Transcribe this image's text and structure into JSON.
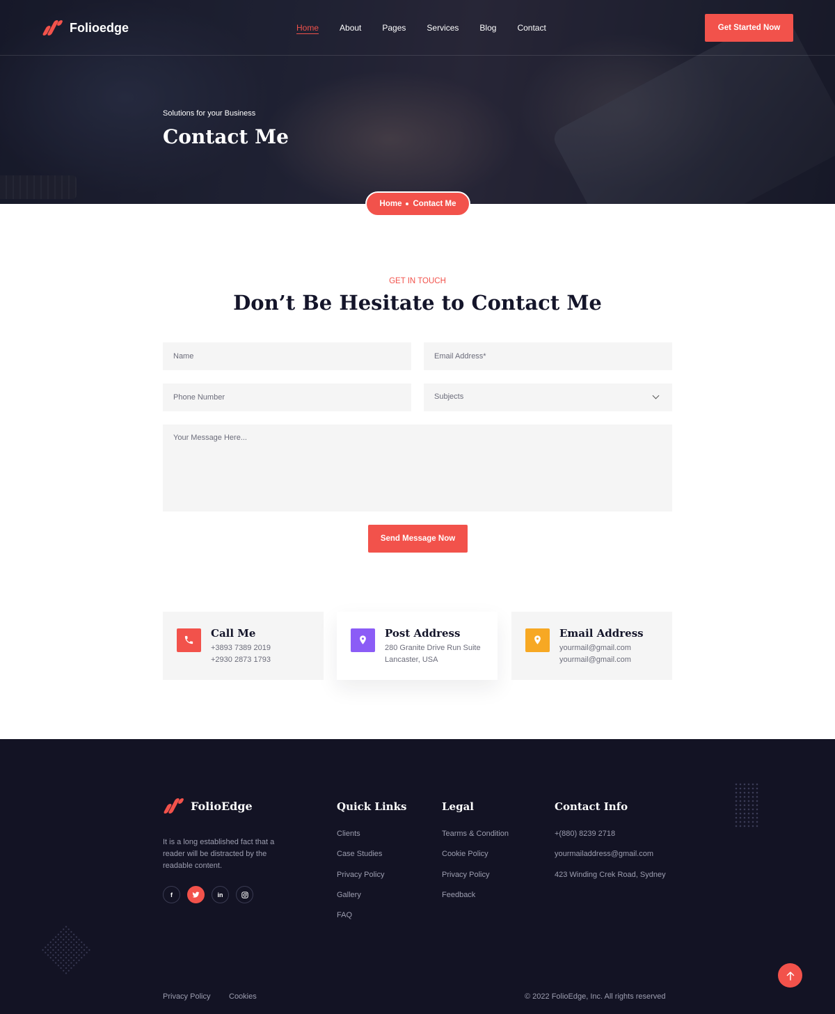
{
  "header": {
    "brand": "Folioedge",
    "nav": [
      "Home",
      "About",
      "Pages",
      "Services",
      "Blog",
      "Contact"
    ],
    "cta_label": "Get Started Now"
  },
  "hero": {
    "subtitle": "Solutions for your Business",
    "title": "Contact Me",
    "breadcrumb": [
      "Home",
      "Contact Me"
    ]
  },
  "contact_section": {
    "kicker": "GET IN TOUCH",
    "title": "Don’t Be Hesitate to Contact Me",
    "fields": {
      "name_placeholder": "Name",
      "email_placeholder": "Email Address*",
      "phone_placeholder": "Phone Number",
      "subject_selected": "Subjects",
      "message_placeholder": "Your Message Here..."
    },
    "submit_label": "Send Message Now"
  },
  "info_cards": [
    {
      "title": "Call Me",
      "lines": [
        "+3893 7389 2019",
        "+2930 2873 1793"
      ],
      "icon": "phone-icon",
      "color": "#f2524b"
    },
    {
      "title": "Post Address",
      "lines": [
        "280 Granite Drive Run Suite",
        "Lancaster, USA"
      ],
      "icon": "location-pin-icon",
      "color": "#8b5cf6"
    },
    {
      "title": "Email Address",
      "lines": [
        "yourmail@gmail.com",
        "yourmail@gmail.com"
      ],
      "icon": "location-pin-icon",
      "color": "#f7a823"
    }
  ],
  "footer": {
    "brand": "FolioEdge",
    "description": "It is a long established fact that a reader will be distracted by the readable content.",
    "social": [
      {
        "label": "f",
        "icon": "facebook-icon"
      },
      {
        "label": "t",
        "icon": "twitter-icon"
      },
      {
        "label": "in",
        "icon": "linkedin-icon"
      },
      {
        "label": "ig",
        "icon": "instagram-icon"
      }
    ],
    "quick_links": {
      "title": "Quick Links",
      "items": [
        "Clients",
        "Case Studies",
        "Privacy Policy",
        "Gallery",
        "FAQ"
      ]
    },
    "legal": {
      "title": "Legal",
      "items": [
        "Tearms & Condition",
        "Cookie Policy",
        "Privacy Policy",
        "Feedback"
      ]
    },
    "contact_info": {
      "title": "Contact Info",
      "items": [
        "+(880) 8239 2718",
        "yourmailaddress@gmail.com",
        "423 Winding Crek Road, Sydney"
      ]
    },
    "bottom_links": [
      "Privacy Policy",
      "Cookies"
    ],
    "copyright": "© 2022 FolioEdge, Inc. All rights reserved"
  },
  "colors": {
    "accent": "#f2524b",
    "dark": "#131324",
    "text": "#14152a",
    "muted": "#6b6c7a"
  }
}
